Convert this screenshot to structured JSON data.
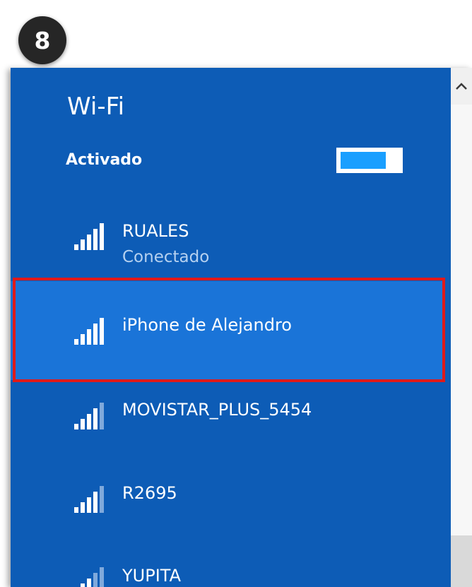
{
  "step_badge": "8",
  "wifi": {
    "title": "Wi-Fi",
    "status": "Activado",
    "toggle_on": true
  },
  "networks": [
    {
      "name": "RUALES",
      "status": "Conectado",
      "signal_bars": 5,
      "selected": false
    },
    {
      "name": "iPhone de Alejandro",
      "status": "",
      "signal_bars": 5,
      "selected": true
    },
    {
      "name": "MOVISTAR_PLUS_5454",
      "status": "",
      "signal_bars": 4,
      "selected": false
    },
    {
      "name": "R2695",
      "status": "",
      "signal_bars": 4,
      "selected": false
    },
    {
      "name": "YUPITA",
      "status": "",
      "signal_bars": 3,
      "selected": false
    }
  ],
  "colors": {
    "panel_bg": "#0d5cb6",
    "selected_bg": "#1a74d8",
    "highlight_border": "#e01a1a",
    "toggle_fill": "#1a9fff"
  },
  "icons": {
    "signal": "wifi-signal-bars-icon",
    "scroll_up": "chevron-up-icon"
  }
}
